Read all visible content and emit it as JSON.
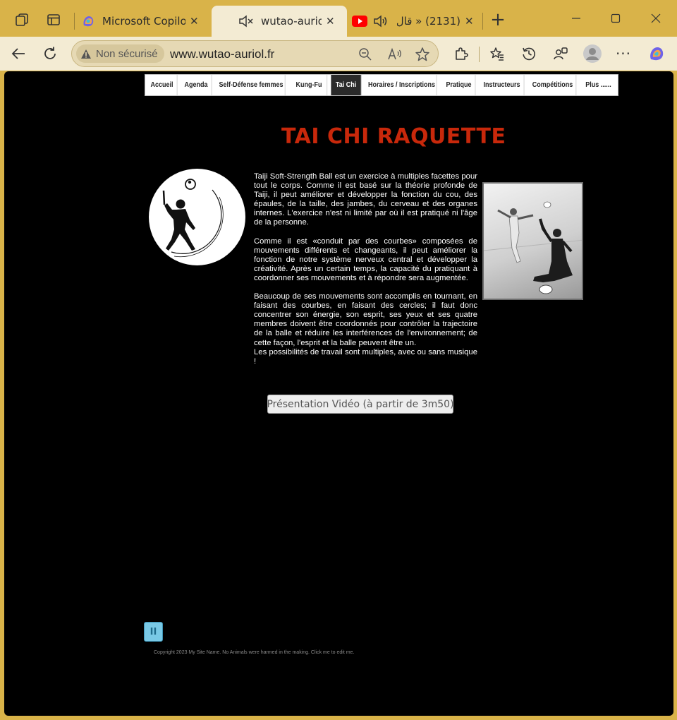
{
  "browser": {
    "tabs": [
      {
        "title": "Microsoft Copilot",
        "active": false
      },
      {
        "title": "wutao-auriol",
        "active": true
      },
      {
        "title": "(2131) « قال",
        "active": false
      }
    ],
    "security_label": "Non sécurisé",
    "url": "www.wutao-auriol.fr",
    "colors": {
      "frame": "#d9b349",
      "toolbar": "#f3ebd3"
    }
  },
  "nav": {
    "items": [
      "Accueil",
      "Agenda",
      "Self-Défense femmes",
      "Kung-Fu",
      "Tai Chi",
      "Horaires / Inscriptions",
      "Pratique",
      "Instructeurs",
      "Compétitions",
      "Plus ......"
    ],
    "active": "Tai Chi"
  },
  "page": {
    "title": "TAI CHI RAQUETTE",
    "title_color": "#c8280b",
    "paragraphs": [
      "Taiji Soft-Strength Ball est un exercice à multiples facettes pour tout le corps. Comme il est basé sur la théorie profonde de Taiji, il peut améliorer et développer la fonction du cou, des épaules, de la taille, des jambes, du cerveau et des organes internes. L'exercice n'est ni limité par où il est pratiqué ni l'âge de la personne.",
      "Comme il est «conduit par des courbes» composées de mouvements différents et changeants, il peut améliorer la fonction de notre système nerveux central et développer la créativité. Après un certain temps, la capacité du pratiquant à coordonner ses mouvements et à répondre sera augmentée.",
      "Beaucoup de ses mouvements sont accomplis en tournant, en faisant des courbes, en faisant des cercles; il faut donc concentrer son énergie, son esprit, ses yeux et ses quatre membres doivent être coordonnés pour contrôler la trajectoire de la balle et réduire les interférences de l'environnement; de cette façon, l'esprit et la balle peuvent être un.",
      "Les possibilités de travail sont multiples, avec ou sans musique !"
    ],
    "video_button": "Présentation Vidéo (à partir de 3m50)",
    "pause_symbol": "II",
    "copyright": "Copyright 2023 My Site Name. No Animals were harmed in the making. Click me to edit me."
  }
}
